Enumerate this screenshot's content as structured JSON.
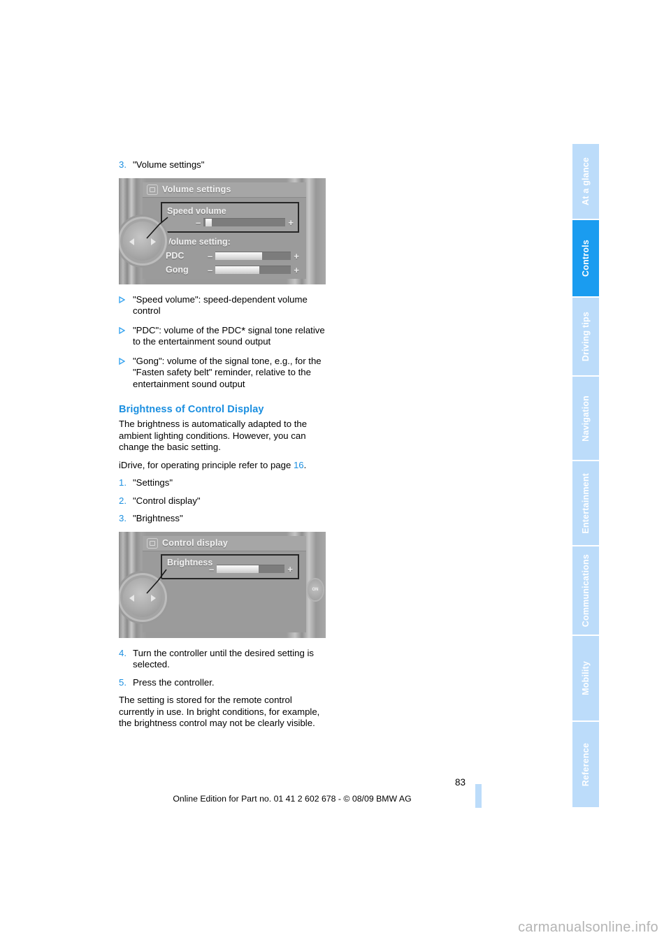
{
  "document": {
    "page_number": "83",
    "edition_footer": "Online Edition for Part no. 01 41 2 602 678 - © 08/09 BMW AG",
    "watermark": "carmanualsonline.info"
  },
  "volume_section": {
    "step3": {
      "marker": "3.",
      "text": "\"Volume settings\""
    },
    "figure": {
      "title": "Volume settings",
      "highlight_label": "Speed volume",
      "group_label": "Volume setting:",
      "rows": [
        {
          "label": "PDC",
          "minus": "–",
          "plus": "+"
        },
        {
          "label": "Gong",
          "minus": "–",
          "plus": "+"
        }
      ],
      "speed_minus": "–",
      "speed_plus": "+"
    },
    "bullets": [
      {
        "text": "\"Speed volume\": speed-dependent volume control"
      },
      {
        "text_before": "\"PDC\": volume of the PDC",
        "star": "*",
        "text_after": " signal tone relative to the entertainment sound output"
      },
      {
        "text": "\"Gong\": volume of the signal tone, e.g., for the \"Fasten safety belt\" reminder, relative to the entertainment sound output"
      }
    ]
  },
  "brightness_section": {
    "heading": "Brightness of Control Display",
    "paragraph1": "The brightness is automatically adapted to the ambient lighting conditions. However, you can change the basic setting.",
    "idrive_note_before": "iDrive, for operating principle refer to page ",
    "idrive_note_page": "16",
    "idrive_note_after": ".",
    "steps": [
      {
        "marker": "1.",
        "text": "\"Settings\""
      },
      {
        "marker": "2.",
        "text": "\"Control display\""
      },
      {
        "marker": "3.",
        "text": "\"Brightness\""
      }
    ],
    "figure": {
      "title": "Control display",
      "highlight_label": "Brightness",
      "minus": "–",
      "plus": "+",
      "right_button": "ON"
    },
    "steps_after": [
      {
        "marker": "4.",
        "text": "Turn the controller until the desired setting is selected."
      },
      {
        "marker": "5.",
        "text": "Press the controller."
      }
    ],
    "paragraph2": "The setting is stored for the remote control currently in use. In bright conditions, for example, the brightness control may not be clearly visible."
  },
  "sidebar": {
    "tabs": [
      {
        "label": "At a glance",
        "active": false
      },
      {
        "label": "Controls",
        "active": true
      },
      {
        "label": "Driving tips",
        "active": false
      },
      {
        "label": "Navigation",
        "active": false
      },
      {
        "label": "Entertainment",
        "active": false
      },
      {
        "label": "Communications",
        "active": false
      },
      {
        "label": "Mobility",
        "active": false
      },
      {
        "label": "Reference",
        "active": false
      }
    ]
  },
  "colors": {
    "accent_blue": "#1b8fe0",
    "tab_active": "#1a9cf0",
    "tab_inactive": "#bcdcfa"
  }
}
